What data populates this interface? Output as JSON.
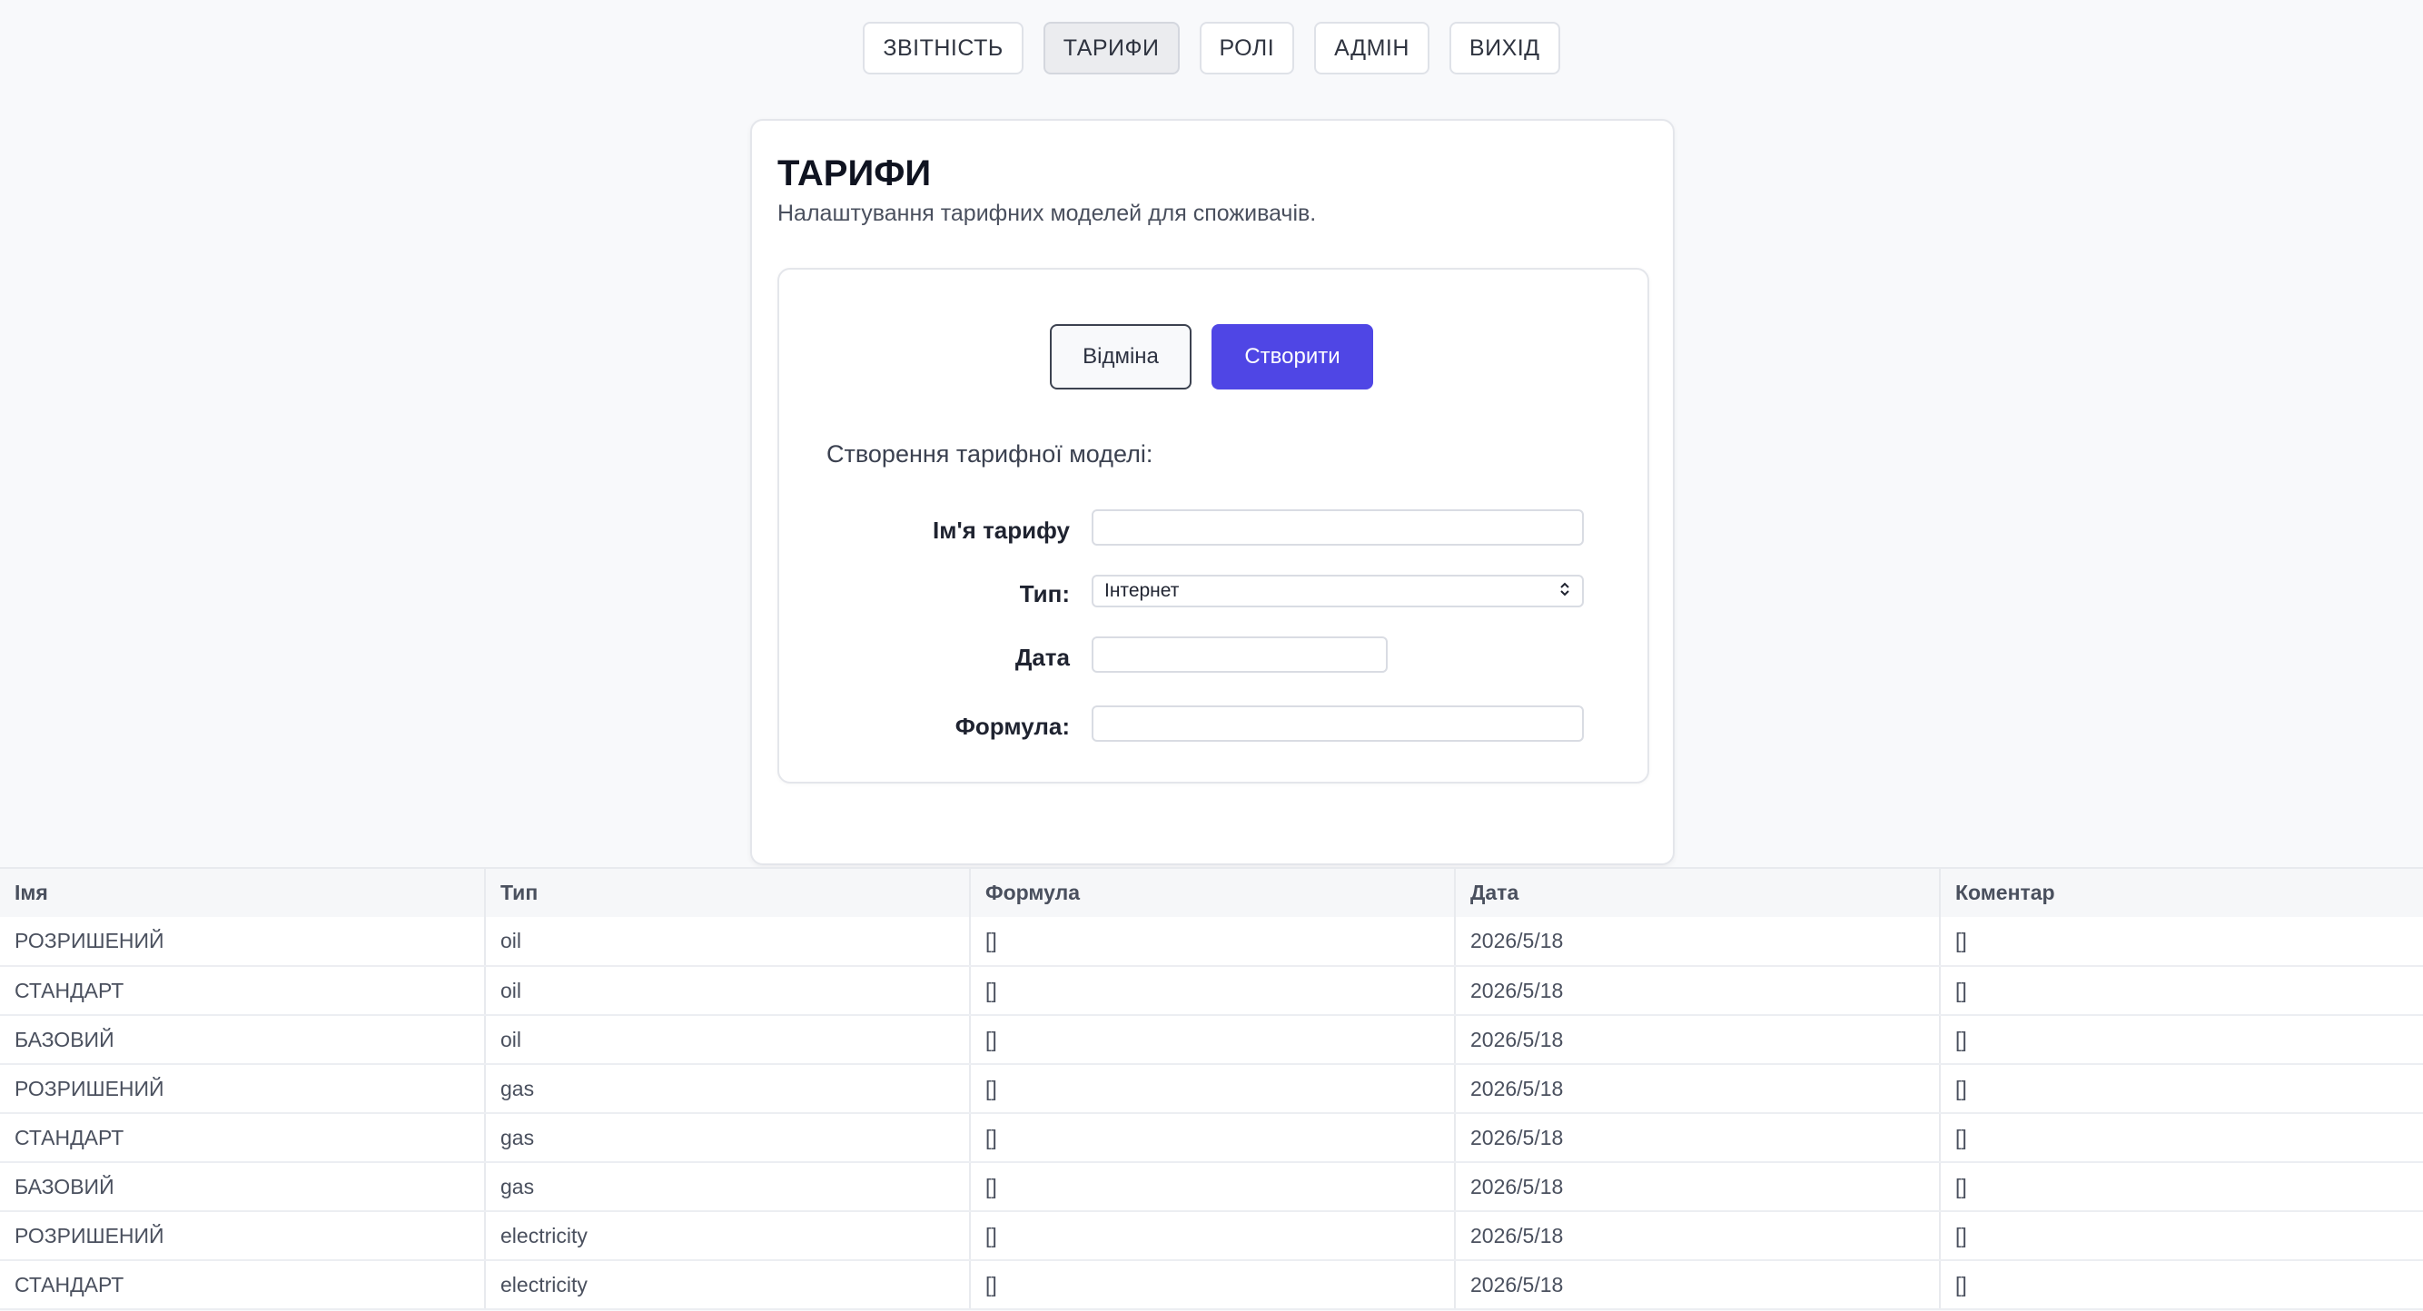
{
  "nav": [
    {
      "label": "ЗВІТНІСТЬ",
      "active": false
    },
    {
      "label": "ТАРИФИ",
      "active": true
    },
    {
      "label": "РОЛІ",
      "active": false
    },
    {
      "label": "АДМІН",
      "active": false
    },
    {
      "label": "ВИХІД",
      "active": false
    }
  ],
  "page": {
    "title": "ТАРИФИ",
    "subtitle": "Налаштування тарифних моделей для споживачів."
  },
  "form": {
    "cancel_label": "Відміна",
    "create_label": "Створити",
    "section_label": "Створення тарифної моделі:",
    "name_label": "Ім'я тарифу",
    "name_value": "",
    "type_label": "Тип:",
    "type_value": "Інтернет",
    "date_label": "Дата",
    "date_value": "",
    "formula_label": "Формула:",
    "formula_value": ""
  },
  "table": {
    "headers": [
      "Імя",
      "Тип",
      "Формула",
      "Дата",
      "Коментар"
    ],
    "rows": [
      [
        "РОЗРИШЕНИЙ",
        "oil",
        "[]",
        "2026/5/18",
        "[]"
      ],
      [
        "СТАНДАРТ",
        "oil",
        "[]",
        "2026/5/18",
        "[]"
      ],
      [
        "БАЗОВИЙ",
        "oil",
        "[]",
        "2026/5/18",
        "[]"
      ],
      [
        "РОЗРИШЕНИЙ",
        "gas",
        "[]",
        "2026/5/18",
        "[]"
      ],
      [
        "СТАНДАРТ",
        "gas",
        "[]",
        "2026/5/18",
        "[]"
      ],
      [
        "БАЗОВИЙ",
        "gas",
        "[]",
        "2026/5/18",
        "[]"
      ],
      [
        "РОЗРИШЕНИЙ",
        "electricity",
        "[]",
        "2026/5/18",
        "[]"
      ],
      [
        "СТАНДАРТ",
        "electricity",
        "[]",
        "2026/5/18",
        "[]"
      ]
    ]
  },
  "colors": {
    "primary": "#4f46e5",
    "background": "#f8f9fb"
  },
  "icons": {
    "select_chevron": "chevron-up-down-icon"
  }
}
